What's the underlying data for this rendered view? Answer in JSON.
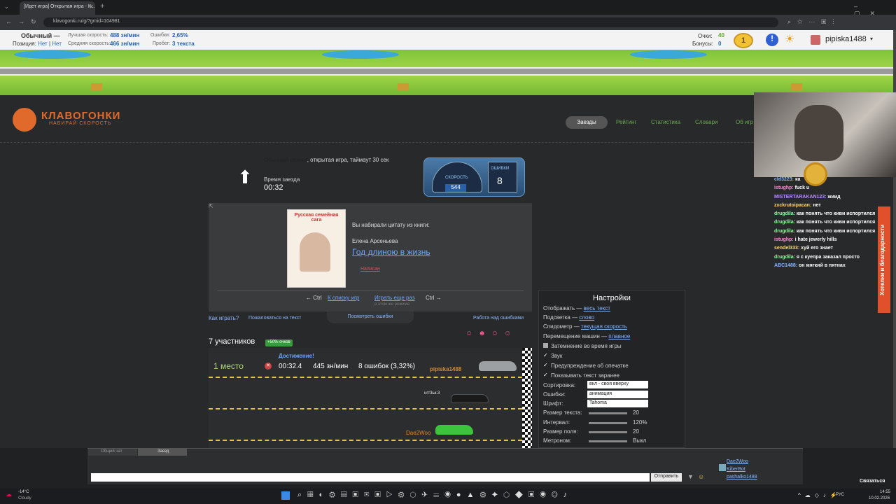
{
  "browser": {
    "tab_title": "[Идет игра] Открытая игра - К...",
    "url": "klavogonki.ru/g/?gmid=104981"
  },
  "stats": {
    "mode": "Обычный —",
    "position_label": "Позиция:",
    "position_v1": "Нет",
    "position_v2": "Нет",
    "best_label": "Лучшая скорость:",
    "best_value": "488 зн/мин",
    "avg_label": "Средняя скорость:",
    "avg_value": "466 зн/мин",
    "err_label": "Ошибки:",
    "err_value": "2,65%",
    "run_label": "Пробег:",
    "run_value": "3 текста",
    "points_label": "Очки:",
    "points_value": "40",
    "bonus_label": "Бонусы:",
    "bonus_value": "0",
    "level": "1",
    "username": "pipiska1488"
  },
  "logo": {
    "title": "КЛАВОГОНКИ",
    "subtitle": "НАБИРАЙ СКОРОСТЬ"
  },
  "nav": [
    "Заезды",
    "Рейтинг",
    "Статистика",
    "Словари",
    "Об игр"
  ],
  "game": {
    "desc_mode": "Обычный режим",
    "desc_rest": ", открытая игра, таймаут 30 сек",
    "time_label": "Время заезда",
    "time_value": "00:32",
    "speed_label": "СКОРОСТЬ",
    "speed_value": "544",
    "errors_label": "ОШИБКИ",
    "errors_value": "8"
  },
  "book": {
    "cover_title": "Русская семейная сага",
    "intro": "Вы набирали цитату из книги:",
    "author": "Елена Арсеньева",
    "title": "Год длиною в жизнь",
    "tag": "Написан",
    "prev": "← Ctrl",
    "list": "К списку игр",
    "again": "Играть еще раз",
    "next": "Ctrl →",
    "again_sub": "в этом же режиме",
    "see_errors": "Посмотреть ошибки"
  },
  "links": {
    "how": "Как играть?",
    "complain": "Пожаловаться на текст",
    "work": "Работа над ошибками"
  },
  "participants": {
    "count": "7 участников",
    "badge": "+50% очков",
    "achievement": "Достижение!",
    "place": "1 место",
    "time": "00:32.4",
    "speed": "445 зн/мин",
    "errors": "8 ошибок (3,32%)",
    "p1": "pipiska1488",
    "p2": "Dae2Woo",
    "p3": "нгт3ьк.3"
  },
  "settings": {
    "title": "Настройки",
    "show": "Отображать —",
    "show_v": "весь текст",
    "hl": "Подсветка —",
    "hl_v": "слово",
    "spd": "Спидометр —",
    "spd_v": "текущая скорость",
    "move": "Перемещение машин —",
    "move_v": "плавное",
    "dark": "Затемнение во время игры",
    "sound": "Звук",
    "warn": "Предупреждение об опечатке",
    "preview": "Показывать текст заранее",
    "sort": "Сортировка:",
    "sort_v": "вкл - своя вверху",
    "errs": "Ошибки:",
    "errs_v": "анимация",
    "font": "Шрифт:",
    "font_v": "Tahoma",
    "tsize": "Размер текста:",
    "tsize_v": "20",
    "interval": "Интервал:",
    "interval_v": "120%",
    "fsize": "Размер поля:",
    "fsize_v": "20",
    "metro": "Метроном:",
    "metro_v": "Выкл"
  },
  "stream_chat": [
    {
      "u": "cld3223:",
      "t": "ка",
      "c": "#8ab6ff"
    },
    {
      "u": "istughp:",
      "t": "fuck u",
      "c": "#ff8ad8"
    },
    {
      "u": "MISTERTARAKAN123:",
      "t": "жиид",
      "c": "#b88aff"
    },
    {
      "u": "zxckrutoipacan:",
      "t": "нет",
      "c": "#ffd86a"
    },
    {
      "u": "drugdila:",
      "t": "как понять что киви испортился",
      "c": "#8aff9c"
    },
    {
      "u": "drugdila:",
      "t": "как понять что киви испортился",
      "c": "#8aff9c"
    },
    {
      "u": "drugdila:",
      "t": "как понять что киви испортился",
      "c": "#8aff9c"
    },
    {
      "u": "istughp:",
      "t": "i hate jewerly hills",
      "c": "#ff8ad8"
    },
    {
      "u": "sendel333:",
      "t": "хуй его знает",
      "c": "#ffd86a"
    },
    {
      "u": "drugdila:",
      "t": "я с куепра заказал просто",
      "c": "#8aff9c"
    },
    {
      "u": "ABC1488:",
      "t": "он мягкий в пятнах",
      "c": "#8ab6ff"
    }
  ],
  "side_tab": "Хотелки и благодарности",
  "chat": {
    "tab1": "Общий чат",
    "tab2": "Заезд",
    "send": "Отправить",
    "users": [
      "Dae2Woo",
      "KiberBot",
      "pashalko1488"
    ],
    "contact": "Связаться"
  },
  "taskbar": {
    "temp": "-14°C",
    "weather": "Cloudy",
    "lang": "РУС",
    "time": "14:55",
    "date": "10.02.2026"
  }
}
